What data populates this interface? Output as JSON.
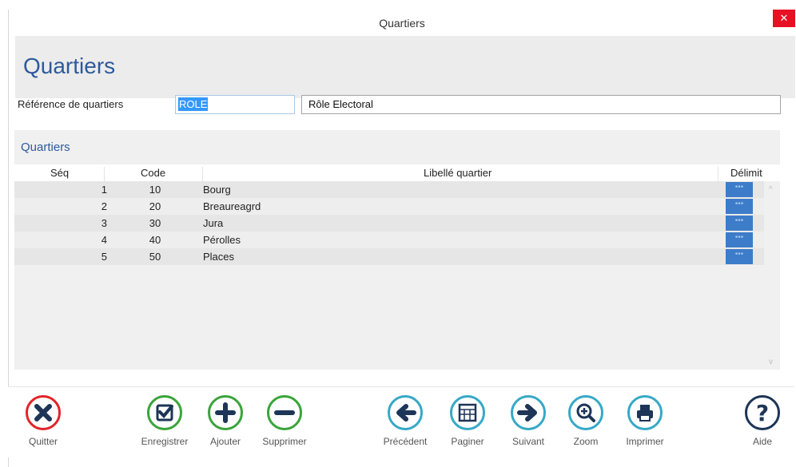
{
  "window": {
    "title": "Quartiers",
    "close_glyph": "✕"
  },
  "header": {
    "title": "Quartiers"
  },
  "reference": {
    "label": "Référence de quartiers",
    "code_value": "ROLE",
    "description_value": "Rôle Electoral"
  },
  "group": {
    "title": "Quartiers"
  },
  "grid": {
    "columns": {
      "seq": "Séq",
      "code": "Code",
      "libelle": "Libellé quartier",
      "delimit": "Délimit"
    },
    "rows": [
      {
        "seq": "1",
        "code": "10",
        "libelle": "Bourg",
        "delimit": "•••"
      },
      {
        "seq": "2",
        "code": "20",
        "libelle": "Breaureagrd",
        "delimit": "•••"
      },
      {
        "seq": "3",
        "code": "30",
        "libelle": "Jura",
        "delimit": "•••"
      },
      {
        "seq": "4",
        "code": "40",
        "libelle": "Pérolles",
        "delimit": "•••"
      },
      {
        "seq": "5",
        "code": "50",
        "libelle": "Places",
        "delimit": "•••"
      }
    ]
  },
  "toolbar": {
    "quitter": "Quitter",
    "enregistrer": "Enregistrer",
    "ajouter": "Ajouter",
    "supprimer": "Supprimer",
    "precedent": "Précédent",
    "paginer": "Paginer",
    "suivant": "Suivant",
    "zoom": "Zoom",
    "imprimer": "Imprimer",
    "aide": "Aide"
  },
  "colors": {
    "accent": "#2d5a9c",
    "close": "#e81123",
    "delimit_button": "#3d7cc9"
  }
}
